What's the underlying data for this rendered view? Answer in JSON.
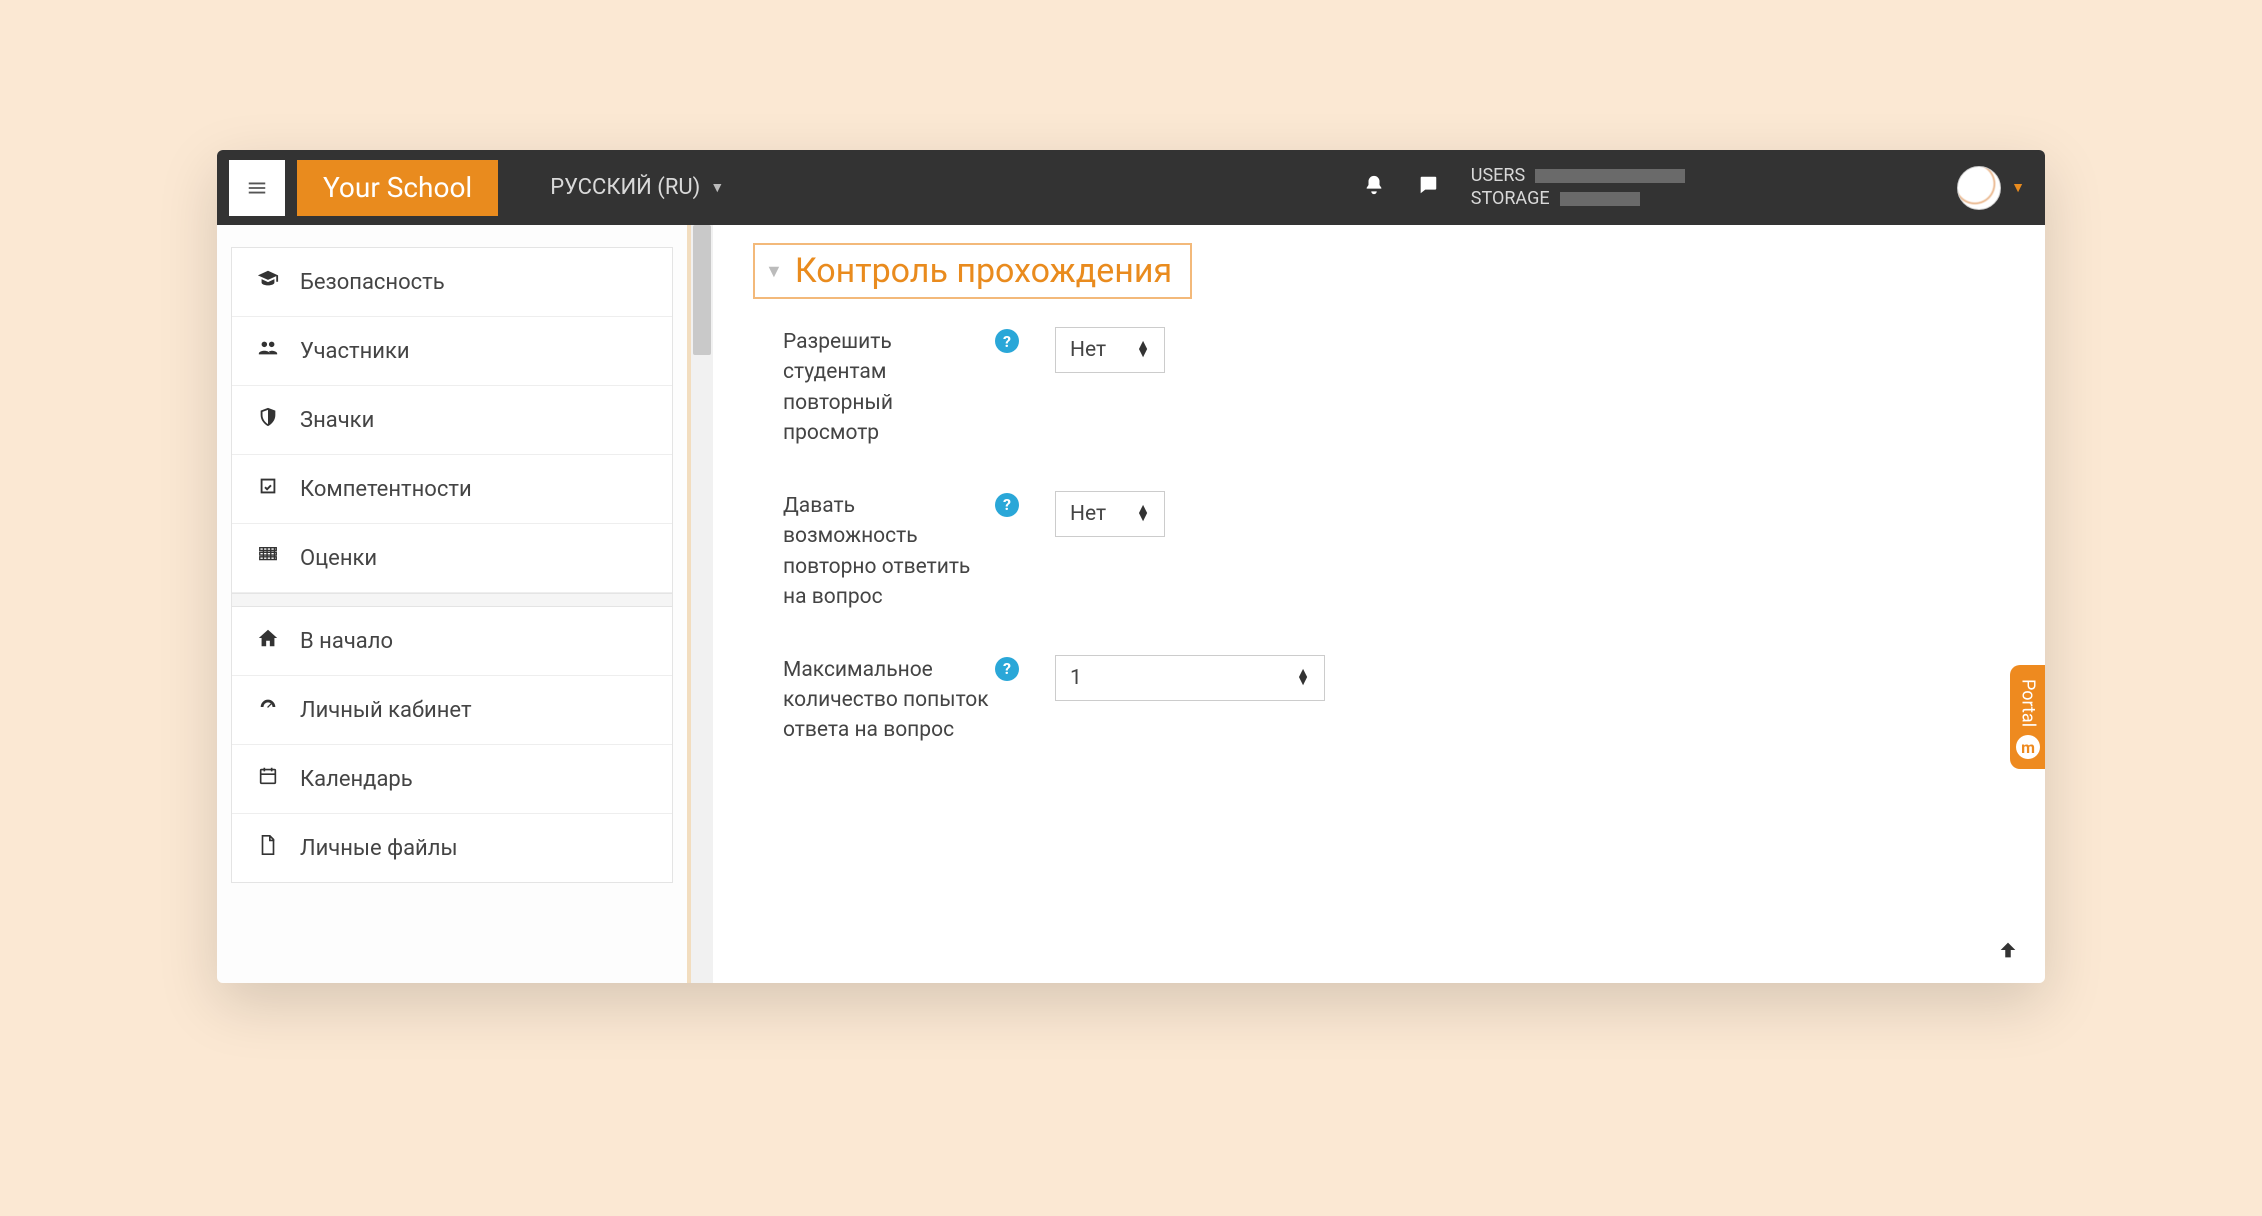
{
  "navbar": {
    "brand": "Your School",
    "language": "РУССКИЙ (RU)",
    "users_label": "USERS",
    "storage_label": "STORAGE"
  },
  "portal_tab": "Portal",
  "sidebar": {
    "group1": [
      {
        "icon": "graduation-cap-icon",
        "label": "Безопасность"
      },
      {
        "icon": "users-icon",
        "label": "Участники"
      },
      {
        "icon": "shield-icon",
        "label": "Значки"
      },
      {
        "icon": "check-square-icon",
        "label": "Компетентности"
      },
      {
        "icon": "grid-icon",
        "label": "Оценки"
      }
    ],
    "group2": [
      {
        "icon": "home-icon",
        "label": "В начало"
      },
      {
        "icon": "dashboard-icon",
        "label": "Личный кабинет"
      },
      {
        "icon": "calendar-icon",
        "label": "Календарь"
      },
      {
        "icon": "file-icon",
        "label": "Личные файлы"
      }
    ]
  },
  "section": {
    "title": "Контроль прохождения",
    "rows": [
      {
        "label": "Разрешить студентам повторный просмотр",
        "value": "Нет",
        "wide": false
      },
      {
        "label": "Давать возможность повторно ответить на вопрос",
        "value": "Нет",
        "wide": false
      },
      {
        "label": "Максимальное количество попыток ответа на вопрос",
        "value": "1",
        "wide": true
      }
    ]
  }
}
